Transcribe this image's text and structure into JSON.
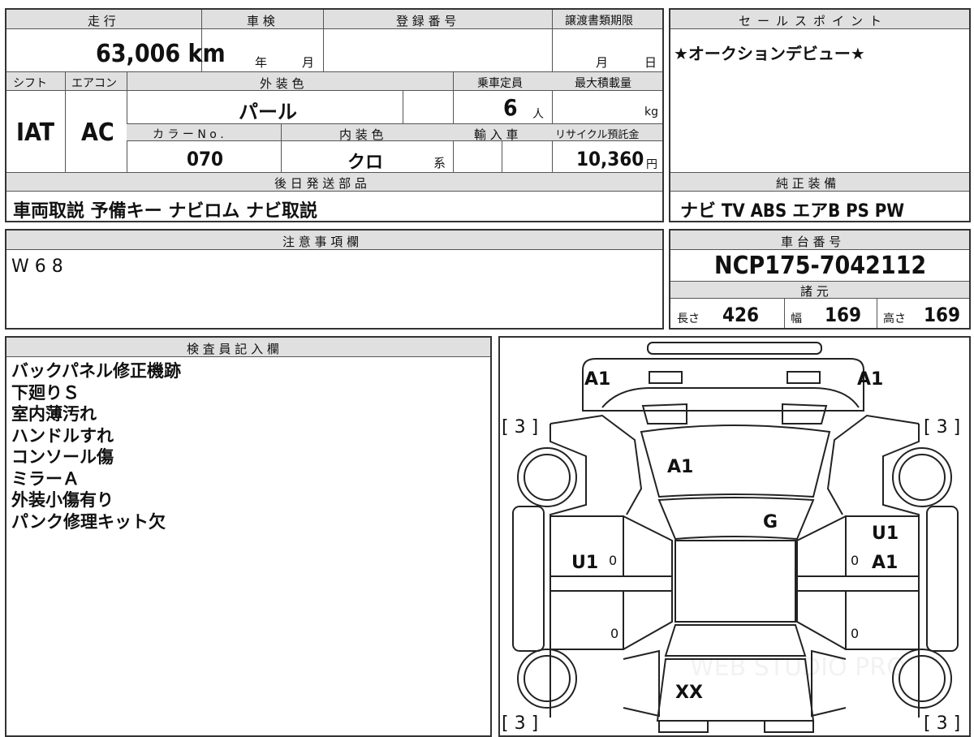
{
  "sheet": {
    "mileage_label": "走 行",
    "mileage": "63,006",
    "mileage_unit": "km",
    "shaken_label": "車 検",
    "shaken_year": "年",
    "shaken_month": "月",
    "reg_no_label": "登 録 番 号",
    "transfer_label": "譲渡書類期限",
    "transfer_month": "月",
    "transfer_day": "日",
    "shift_label": "シフト",
    "shift": "IAT",
    "ac_label": "エアコン",
    "ac": "AC",
    "exterior_label": "外 装 色",
    "exterior": "パール",
    "capacity_label": "乗車定員",
    "capacity": "6",
    "capacity_unit": "人",
    "maxload_label": "最大積載量",
    "maxload_unit": "kg",
    "color_no_label": "カ ラ ー N o .",
    "color_no": "070",
    "interior_label": "内 装 色",
    "interior": "クロ",
    "interior_suffix": "系",
    "import_label": "輸 入 車",
    "recycle_label": "リサイクル預託金",
    "recycle": "10,360",
    "recycle_unit": "円",
    "later_parts_label": "後 日 発 送 部 品",
    "later_parts": "車両取説 予備キー ナビロム ナビ取説",
    "sales_label": "セールスポイント",
    "sales_point": "★オークションデビュー★",
    "equip_label": "純 正 装 備",
    "equipment": "ナビ TV ABS エアB PS PW",
    "notes_label": "注 意 事 項 欄",
    "notes": "W 6 8",
    "chassis_label": "車 台 番 号",
    "chassis_no": "NCP175-7042112",
    "specs_label": "諸 元",
    "length_label": "長さ",
    "length": "426",
    "width_label": "幅",
    "width": "169",
    "height_label": "高さ",
    "height": "169",
    "inspector_label": "検 査 員 記 入 欄",
    "inspector_notes": [
      "バックパネル修正機跡",
      "下廻りＳ",
      "室内薄汚れ",
      "ハンドルすれ",
      "コンソール傷",
      "ミラーＡ",
      "外装小傷有り",
      "パンク修理キット欠"
    ]
  },
  "diagram": {
    "front_left": "A1",
    "front_right": "A1",
    "tire_fl": "[ 3 ]",
    "tire_fr": "[ 3 ]",
    "tire_rl": "[ 3 ]",
    "tire_rr": "[ 3 ]",
    "hood": "A1",
    "windshield": "G",
    "left_front_door": "U1",
    "right_front_door_top": "U1",
    "right_front_door": "A1",
    "small_0_a": "0",
    "small_0_b": "0",
    "small_0_c": "0",
    "small_0_d": "0",
    "trunk": "XX",
    "watermark": "WEB STUDIO PRO"
  }
}
